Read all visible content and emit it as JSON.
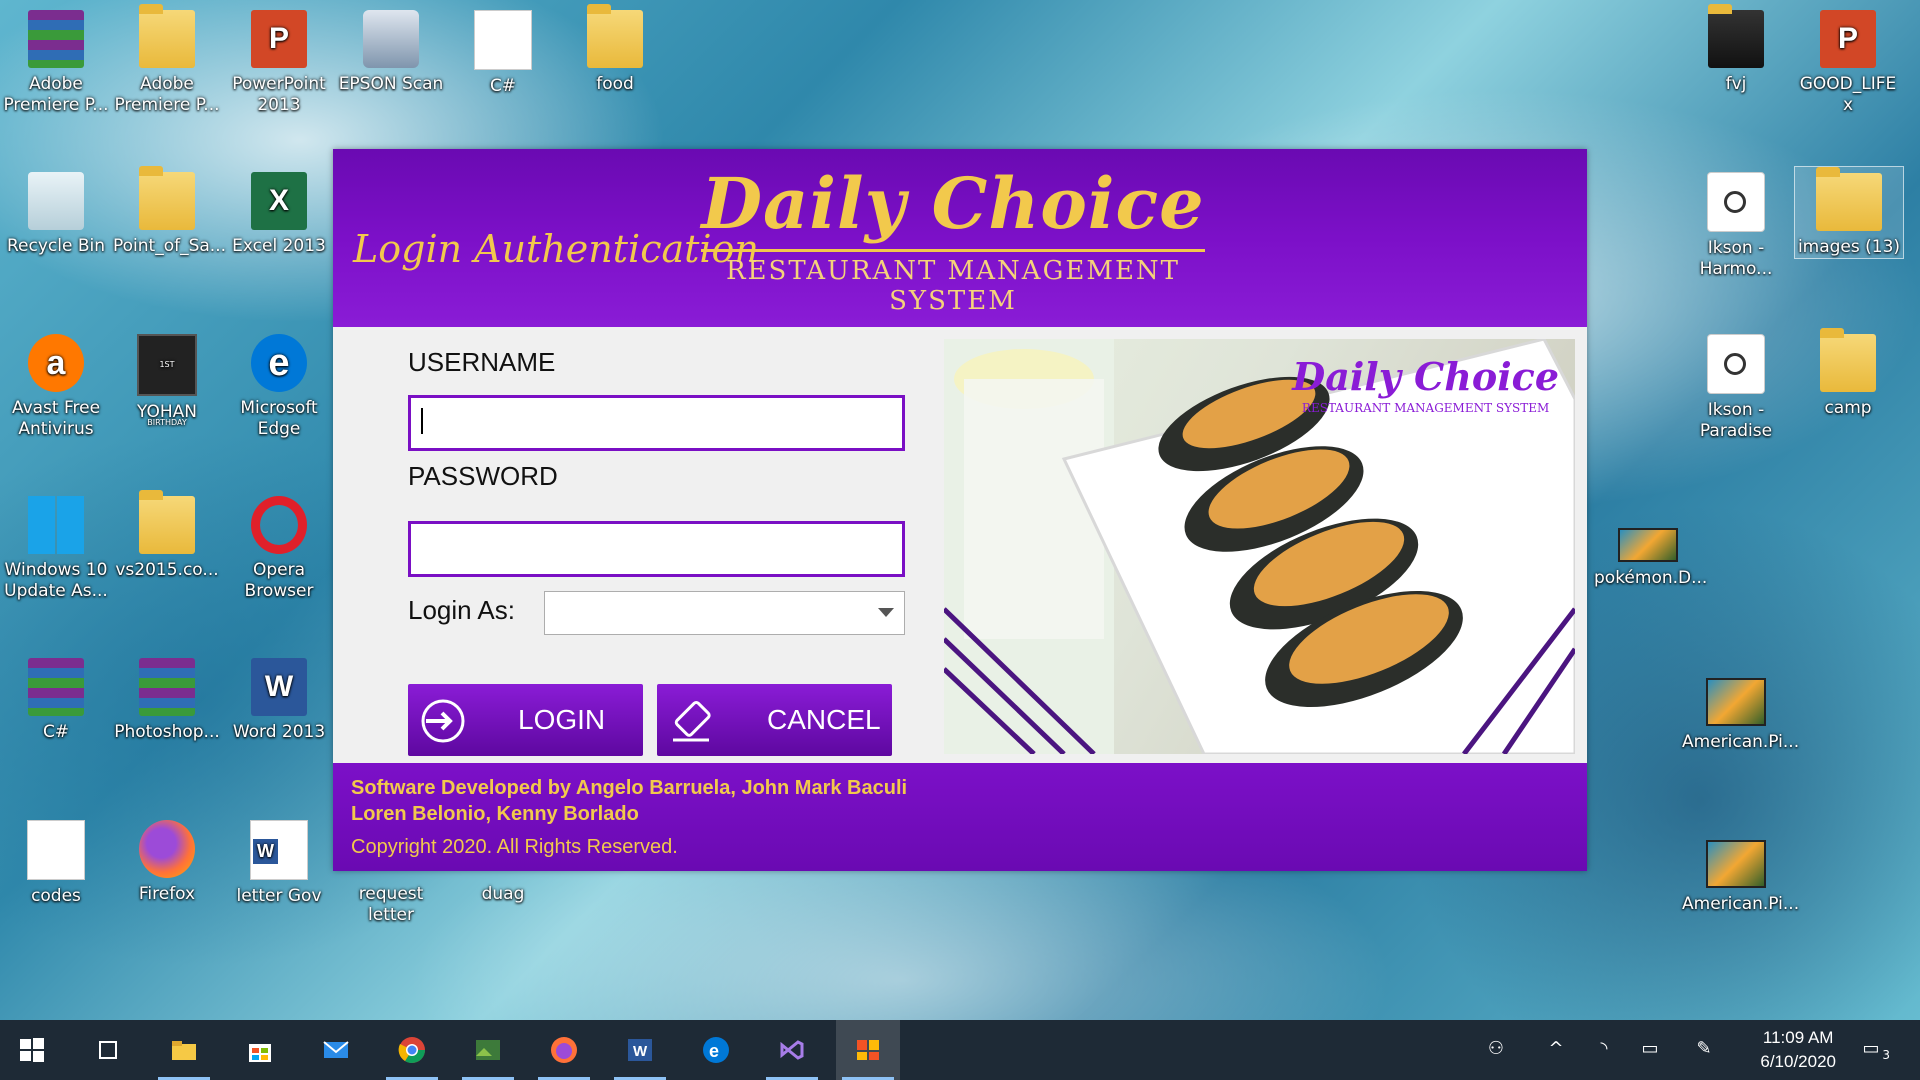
{
  "desktop_icons": [
    {
      "label": "Adobe Premiere P...",
      "icon": "winrar-icon"
    },
    {
      "label": "Adobe Premiere P...",
      "icon": "folder-icon"
    },
    {
      "label": "PowerPoint 2013",
      "icon": "powerpoint-icon",
      "glyph": "P"
    },
    {
      "label": "EPSON Scan",
      "icon": "scanner-icon"
    },
    {
      "label": "C#",
      "icon": "document-icon"
    },
    {
      "label": "food",
      "icon": "folder-icon"
    },
    {
      "label": "fvj",
      "icon": "folder-icon"
    },
    {
      "label": "GOOD_LIFE x",
      "icon": "powerpoint-icon",
      "glyph": "P"
    },
    {
      "label": "Recycle Bin",
      "icon": "recycle-bin-icon"
    },
    {
      "label": "Point_of_Sa...",
      "icon": "folder-icon"
    },
    {
      "label": "Excel 2013",
      "icon": "excel-icon",
      "glyph": "X"
    },
    {
      "label": "Ikson - Harmo...",
      "icon": "audio-file-icon"
    },
    {
      "label": "images (13)",
      "icon": "folder-icon"
    },
    {
      "label": "Avast Free Antivirus",
      "icon": "avast-icon",
      "glyph": "a"
    },
    {
      "label": "YOHAN",
      "icon": "video-thumbnail-icon",
      "glyph": "1ST BIRTHDAY"
    },
    {
      "label": "Microsoft Edge",
      "icon": "edge-icon",
      "glyph": "e"
    },
    {
      "label": "Ikson - Paradise",
      "icon": "audio-file-icon"
    },
    {
      "label": "camp",
      "icon": "folder-icon"
    },
    {
      "label": "Windows 10 Update As...",
      "icon": "windows-update-icon"
    },
    {
      "label": "vs2015.co...",
      "icon": "folder-icon"
    },
    {
      "label": "Opera Browser",
      "icon": "opera-icon"
    },
    {
      "label": "pokémon.D...",
      "icon": "video-thumbnail-icon"
    },
    {
      "label": "C#",
      "icon": "winrar-icon"
    },
    {
      "label": "Photoshop...",
      "icon": "winrar-icon"
    },
    {
      "label": "Word 2013",
      "icon": "word-icon",
      "glyph": "W"
    },
    {
      "label": "American.Pi...",
      "icon": "image-thumbnail-icon"
    },
    {
      "label": "codes",
      "icon": "document-icon"
    },
    {
      "label": "Firefox",
      "icon": "firefox-icon"
    },
    {
      "label": "letter Gov",
      "icon": "word-doc-icon",
      "glyph": "W"
    },
    {
      "label": "request letter",
      "icon": "word-doc-icon"
    },
    {
      "label": "duag",
      "icon": "word-doc-icon"
    },
    {
      "label": "American.Pi...",
      "icon": "image-thumbnail-icon"
    }
  ],
  "app": {
    "header_title": "Login Authentication",
    "brand_name": "Daily Choice",
    "brand_subtitle": "RESTAURANT MANAGEMENT SYSTEM",
    "username_label": "USERNAME",
    "username_value": "",
    "password_label": "PASSWORD",
    "password_value": "",
    "login_as_label": "Login As:",
    "login_as_value": "",
    "login_button": "LOGIN",
    "cancel_button": "CANCEL",
    "panel_brand_name": "Daily Choice",
    "panel_brand_subtitle": "RESTAURANT MANAGEMENT SYSTEM",
    "credits_line1": "Software Developed by Angelo Barruela, John Mark Baculi",
    "credits_line2": "Loren Belonio, Kenny Borlado",
    "copyright": "Copyright 2020. All Rights Reserved.",
    "colors": {
      "purple": "#7c10c8",
      "gold": "#f2c94c"
    }
  },
  "taskbar": {
    "apps": [
      {
        "name": "task-view-icon"
      },
      {
        "name": "file-explorer-icon"
      },
      {
        "name": "microsoft-store-icon"
      },
      {
        "name": "mail-icon"
      },
      {
        "name": "chrome-icon"
      },
      {
        "name": "photos-icon"
      },
      {
        "name": "firefox-icon"
      },
      {
        "name": "word-icon"
      },
      {
        "name": "edge-icon"
      },
      {
        "name": "visual-studio-icon"
      },
      {
        "name": "running-app-icon"
      }
    ],
    "time": "11:09 AM",
    "date": "6/10/2020",
    "notification_count": "3"
  }
}
